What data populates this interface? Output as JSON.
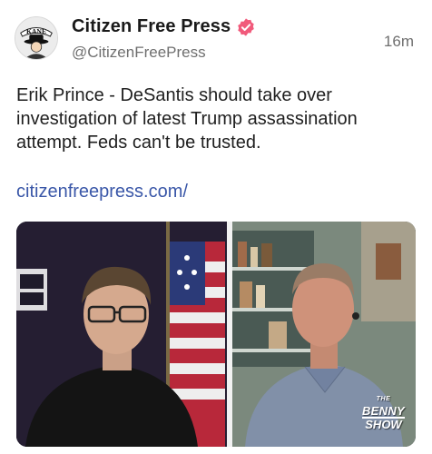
{
  "author": {
    "display_name": "Citizen Free Press",
    "handle": "@CitizenFreePress",
    "avatar_text": "KANE",
    "verified": true,
    "verified_icon": "verified-badge-icon"
  },
  "post": {
    "timestamp": "16m",
    "text": "Erik Prince - DeSantis should take over investigation of latest Trump assassination attempt. Feds can't be trusted.",
    "link": "citizenfreepress.com/"
  },
  "media": {
    "type": "video-still",
    "watermark": {
      "small": "THE",
      "line1": "BENNY",
      "line2": "SHOW"
    }
  },
  "colors": {
    "accent_verified": "#f15a7b",
    "link": "#3a57a8",
    "muted": "#6f6f6f"
  }
}
